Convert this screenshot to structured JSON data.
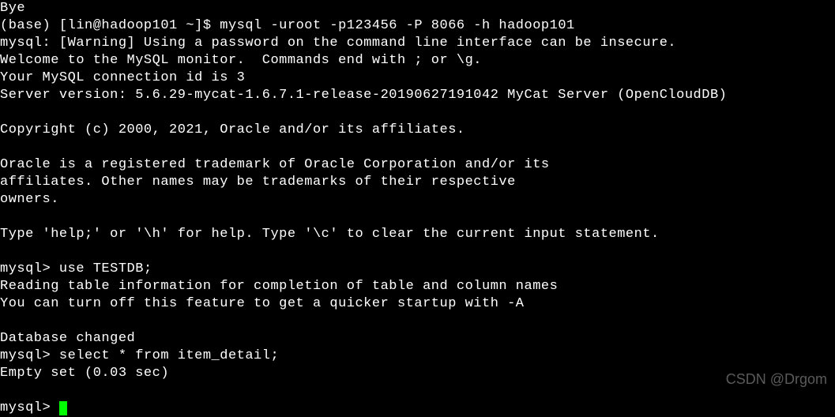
{
  "terminal": {
    "line_bye": "Bye",
    "prompt1_prefix": "(base) [lin@hadoop101 ~]$ ",
    "command1": "mysql -uroot -p123456 -P 8066 -h hadoop101",
    "warning": "mysql: [Warning] Using a password on the command line interface can be insecure.",
    "welcome": "Welcome to the MySQL monitor.  Commands end with ; or \\g.",
    "connection_id": "Your MySQL connection id is 3",
    "server_version": "Server version: 5.6.29-mycat-1.6.7.1-release-20190627191042 MyCat Server (OpenCloudDB)",
    "copyright": "Copyright (c) 2000, 2021, Oracle and/or its affiliates.",
    "trademark1": "Oracle is a registered trademark of Oracle Corporation and/or its",
    "trademark2": "affiliates. Other names may be trademarks of their respective",
    "trademark3": "owners.",
    "help_hint": "Type 'help;' or '\\h' for help. Type '\\c' to clear the current input statement.",
    "mysql_prompt": "mysql> ",
    "command2": "use TESTDB;",
    "reading": "Reading table information for completion of table and column names",
    "turnoff": "You can turn off this feature to get a quicker startup with -A",
    "db_changed": "Database changed",
    "command3": "select * from item_detail;",
    "empty_set": "Empty set (0.03 sec)"
  },
  "watermark": "CSDN @Drgom"
}
